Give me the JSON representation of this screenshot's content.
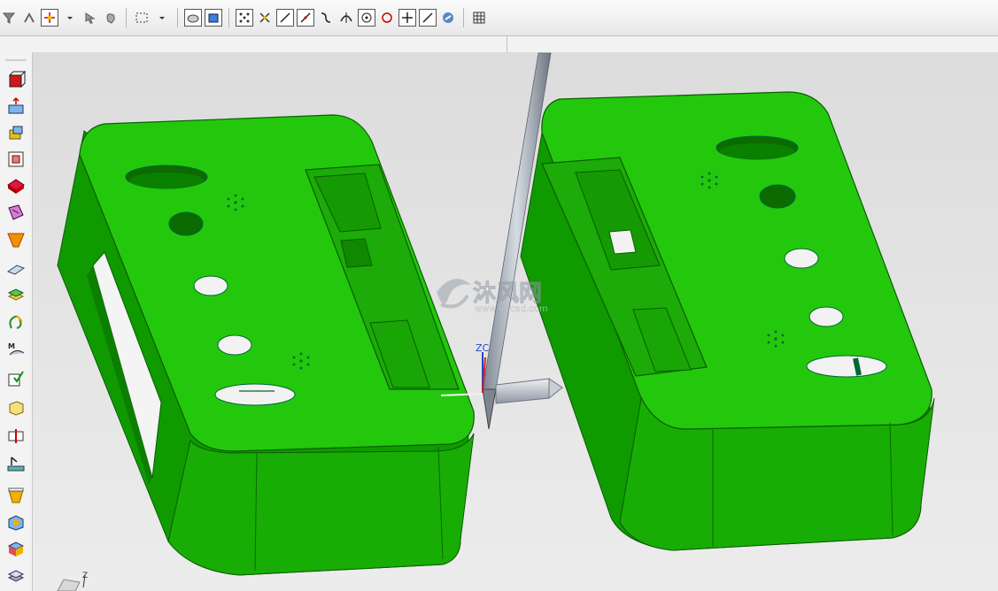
{
  "watermark": {
    "title": "沐风网",
    "url": "www.mfcad.com"
  },
  "axis": {
    "main_label": "ZC",
    "triad_label": "Z"
  },
  "toolbar_icons": [
    "select-filter-icon",
    "snap-point-icon",
    "point-constructor-icon",
    "arrow-pick-icon",
    "hand-pick-icon",
    "rect-select-icon",
    "view-shaded-icon",
    "view-solid-icon",
    "snap-points-icon",
    "snap-intersect-icon",
    "line-icon",
    "line-diag-icon",
    "curve-icon",
    "arc-icon",
    "circle-center-icon",
    "circle-icon",
    "cross-icon",
    "line-point-icon",
    "tool-icon",
    "grid-icon"
  ],
  "left_tools": [
    "block-feature-icon",
    "extrude-icon",
    "move-face-icon",
    "sketch-icon",
    "solid-icon",
    "draft-icon",
    "face-blend-icon",
    "plane-icon",
    "stack-icon",
    "curve-loop-icon",
    "measure-icon",
    "check-icon",
    "box-icon",
    "split-body-icon",
    "draft-analysis-icon",
    "mold-wizard-icon",
    "parting-icon",
    "tool-box-icon",
    "layer-icon"
  ],
  "colors": {
    "part_green": "#1fc708",
    "part_dark": "#0e8f00",
    "viewport_top": "#dddddd",
    "viewport_bottom": "#e9e9e9"
  }
}
